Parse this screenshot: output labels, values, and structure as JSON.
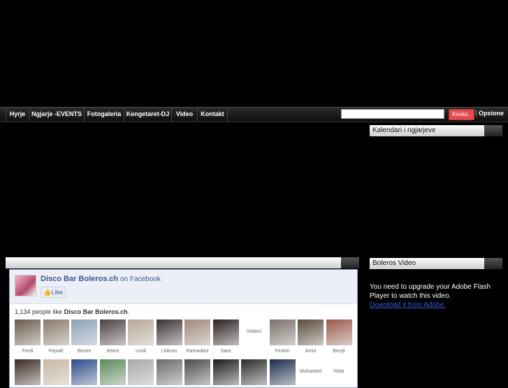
{
  "nav": {
    "items": [
      "Hyrje",
      "Ngjarje -EVENTS",
      "Fotogaleria",
      "Kengetaret-DJ",
      "Video",
      "Kontakt"
    ],
    "search_placeholder": "",
    "search_button": "Kesko..",
    "separator": "|",
    "options": "Opsione"
  },
  "sidebar": {
    "calendar_title": "Kalendari i ngjarjeve",
    "video_title": "Boleros Video",
    "flash_message": "You need to upgrade your Adobe Flash Player to watch this video.",
    "flash_link": "Download it from Adobe."
  },
  "main": {
    "box_title": ""
  },
  "facebook": {
    "page_name": "Disco Bar Boleros.ch",
    "on_facebook": "on Facebook",
    "like_label": "Like",
    "count_prefix": "1,134 people like",
    "count_page": "Disco Bar Boleros.ch",
    "count_suffix": ".",
    "fans_row1": [
      {
        "name": "Ferdi",
        "color": "#6a5a4a"
      },
      {
        "name": "Fejsall",
        "color": "#8a7a6a"
      },
      {
        "name": "Besim",
        "color": "#8aa0b8"
      },
      {
        "name": "Jetmir",
        "color": "#4a4040"
      },
      {
        "name": "Lindi",
        "color": "#b8a898"
      },
      {
        "name": "Llokum",
        "color": "#3a3030"
      },
      {
        "name": "Ramadani",
        "color": "#a08878"
      },
      {
        "name": "Sara",
        "color": "#2a2020"
      },
      {
        "name": "Selami",
        "color": ""
      },
      {
        "name": "Festim",
        "color": "#7a7068"
      },
      {
        "name": "Amiri",
        "color": "#5a4a3a"
      },
      {
        "name": "Benjit",
        "color": "#9a5a4a"
      }
    ],
    "fans_row2": [
      {
        "name": "",
        "color": "#3a2a20"
      },
      {
        "name": "",
        "color": "#c8b8a0"
      },
      {
        "name": "",
        "color": "#2a4a8a"
      },
      {
        "name": "",
        "color": "#5a8a5a"
      },
      {
        "name": "",
        "color": "#a8a8a8"
      },
      {
        "name": "",
        "color": "#6a6a6a"
      },
      {
        "name": "",
        "color": "#4a4a4a"
      },
      {
        "name": "",
        "color": "#1a1a1a"
      },
      {
        "name": "",
        "color": "#2a2a2a"
      },
      {
        "name": "",
        "color": "#1a2a4a"
      },
      {
        "name": "Muhamed",
        "color": ""
      },
      {
        "name": "Rela",
        "color": ""
      }
    ]
  }
}
